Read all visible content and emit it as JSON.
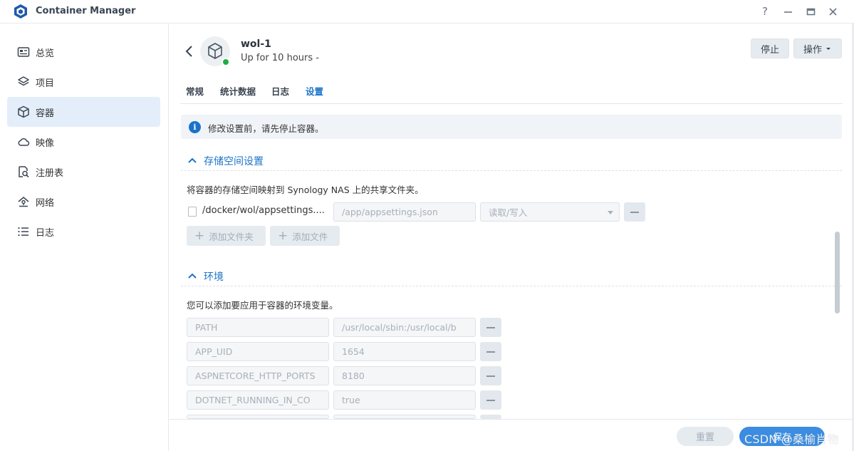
{
  "app": {
    "title": "Container Manager",
    "controls": {
      "help": "?",
      "minimize": "—",
      "maximize": "□",
      "close": "✕"
    }
  },
  "sidebar": {
    "items": [
      {
        "label": "总览",
        "icon": "overview-icon"
      },
      {
        "label": "项目",
        "icon": "layers-icon"
      },
      {
        "label": "容器",
        "icon": "cube-icon",
        "active": true
      },
      {
        "label": "映像",
        "icon": "cloud-icon"
      },
      {
        "label": "注册表",
        "icon": "registry-search-icon"
      },
      {
        "label": "网络",
        "icon": "network-icon"
      },
      {
        "label": "日志",
        "icon": "list-icon"
      }
    ]
  },
  "container": {
    "name": "wol-1",
    "status": "Up for 10 hours -",
    "status_color": "#1fae42"
  },
  "actions": {
    "stop": "停止",
    "operate": "操作"
  },
  "tabs": [
    {
      "label": "常规"
    },
    {
      "label": "统计数据"
    },
    {
      "label": "日志"
    },
    {
      "label": "设置",
      "active": true
    }
  ],
  "info": {
    "text": "修改设置前，请先停止容器。"
  },
  "storage": {
    "title": "存储空间设置",
    "description": "将容器的存储空间映射到 Synology NAS 上的共享文件夹。",
    "mapping": {
      "host_path": "/docker/wol/appsettings....",
      "container_path": "/app/appsettings.json",
      "permission": "读取/写入"
    },
    "add_folder": "添加文件夹",
    "add_file": "添加文件"
  },
  "environment": {
    "title": "环境",
    "description": "您可以添加要应用于容器的环境变量。",
    "variables": [
      {
        "key": "PATH",
        "value": "/usr/local/sbin:/usr/local/b"
      },
      {
        "key": "APP_UID",
        "value": "1654"
      },
      {
        "key": "ASPNETCORE_HTTP_PORTS",
        "value": "8180"
      },
      {
        "key": "DOTNET_RUNNING_IN_CO",
        "value": "true"
      }
    ]
  },
  "footer": {
    "reset": "重置",
    "save": "保存"
  },
  "watermark": "CSDN @桑榆肖物",
  "colors": {
    "accent": "#1b73c9",
    "active_nav_bg": "#e3eefa"
  }
}
